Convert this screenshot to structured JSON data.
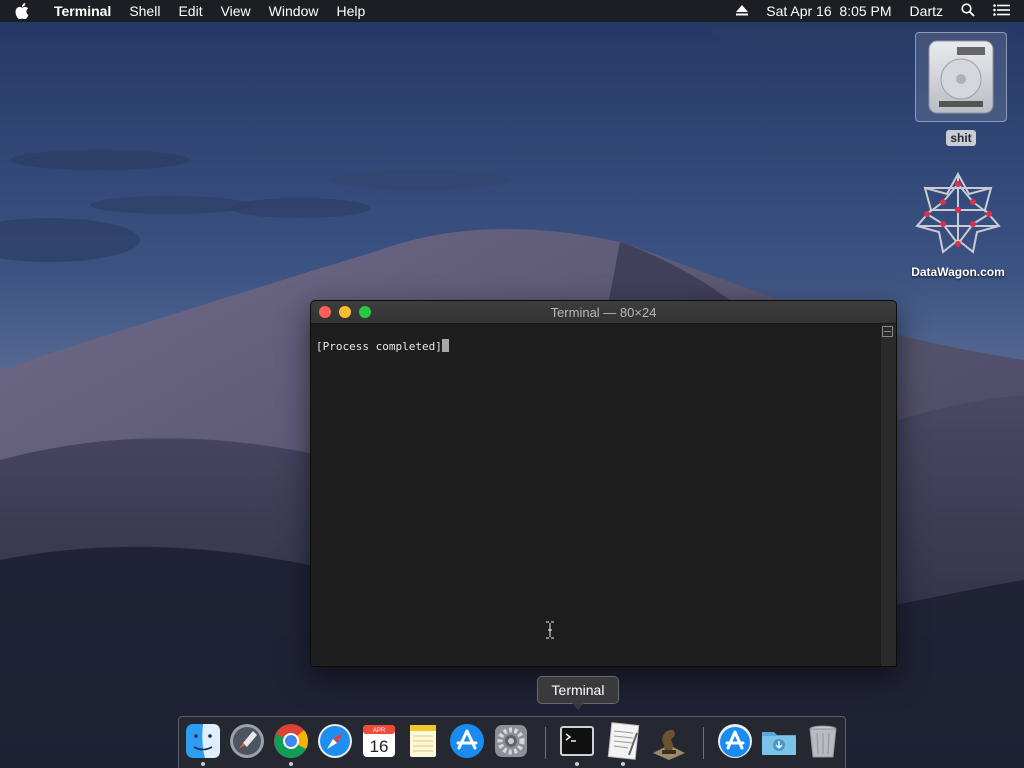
{
  "menubar": {
    "app_name": "Terminal",
    "items": [
      "Shell",
      "Edit",
      "View",
      "Window",
      "Help"
    ],
    "datetime": "Sat Apr 16  8:05 PM",
    "user": "Dartz"
  },
  "desktop": {
    "icons": [
      {
        "label": "shit",
        "icon": "hard-drive-icon"
      },
      {
        "label": "DataWagon.com",
        "icon": "wolfram-star-icon"
      }
    ]
  },
  "terminal": {
    "title": "Terminal — 80×24",
    "content": "[Process completed]"
  },
  "tooltip": {
    "text": "Terminal"
  },
  "dock": {
    "calendar_month": "APR",
    "calendar_day": "16",
    "items": [
      {
        "app": "Finder",
        "icon": "finder-icon"
      },
      {
        "app": "Launchpad",
        "icon": "launchpad-icon"
      },
      {
        "app": "Chrome",
        "icon": "chrome-icon"
      },
      {
        "app": "Safari",
        "icon": "safari-icon"
      },
      {
        "app": "Calendar",
        "icon": "calendar-icon"
      },
      {
        "app": "Notes",
        "icon": "notes-icon"
      },
      {
        "app": "App Store",
        "icon": "app-store-icon"
      },
      {
        "app": "System Preferences",
        "icon": "system-preferences-icon"
      },
      {
        "app": "Terminal",
        "icon": "terminal-icon"
      },
      {
        "app": "TextEdit",
        "icon": "textedit-icon"
      },
      {
        "app": "Chess",
        "icon": "chess-icon"
      },
      {
        "app": "App Store Downloads",
        "icon": "app-store-downloads-icon"
      },
      {
        "app": "Downloads",
        "icon": "downloads-folder-icon"
      },
      {
        "app": "Trash",
        "icon": "trash-icon"
      }
    ]
  },
  "colors": {
    "close": "#fe5f57",
    "minimize": "#febc2e",
    "maximize": "#28c840",
    "terminal_bg": "#1e1e1e"
  }
}
